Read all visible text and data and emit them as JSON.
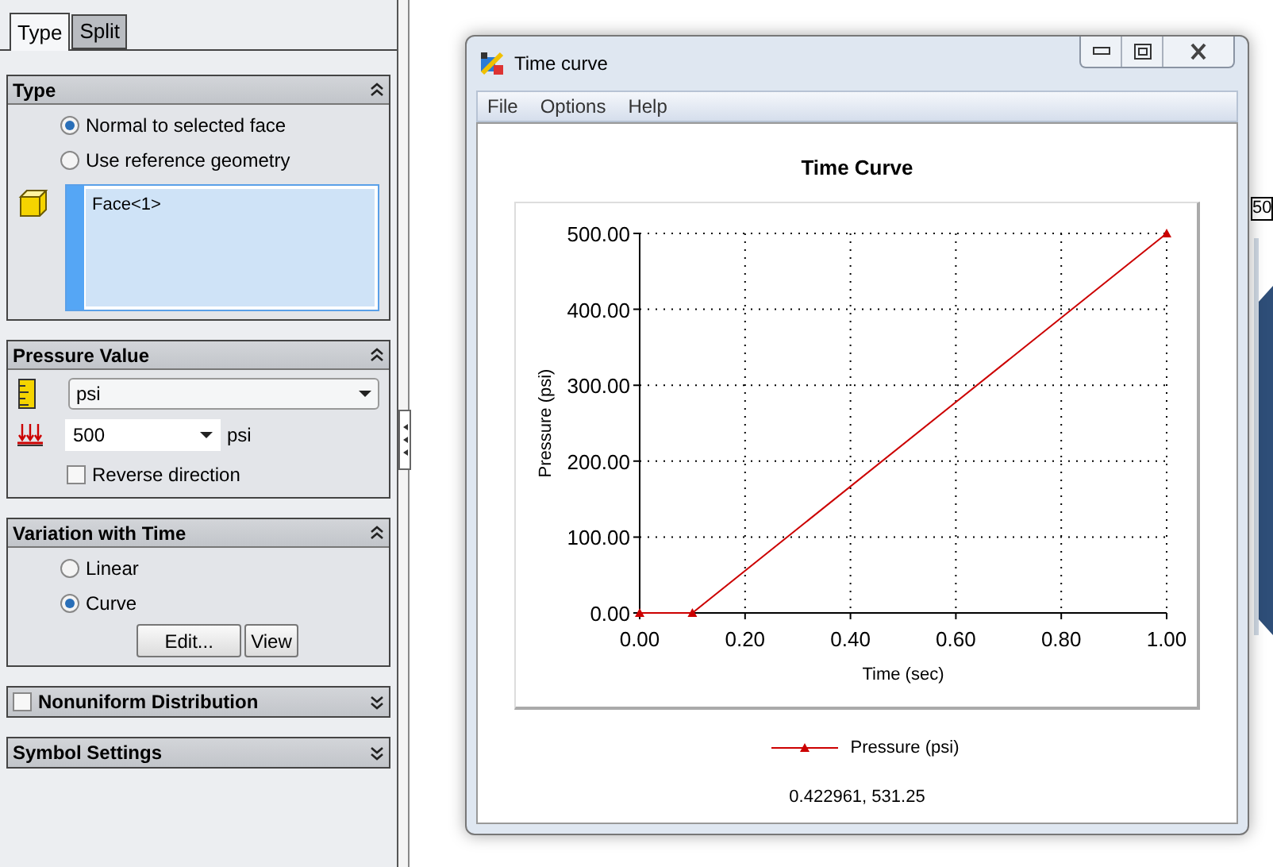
{
  "property_panel": {
    "tabs": [
      {
        "label": "Type",
        "selected": true
      },
      {
        "label": "Split",
        "selected": false
      }
    ],
    "sections": [
      {
        "kind": "type",
        "title": "Type",
        "expanded": true,
        "options": [
          {
            "label": "Normal to selected face",
            "selected": true
          },
          {
            "label": "Use reference geometry",
            "selected": false
          }
        ],
        "selection_list": [
          "Face<1>"
        ]
      },
      {
        "kind": "pressure",
        "title": "Pressure Value",
        "expanded": true,
        "unit_select": "psi",
        "value": "500",
        "value_unit": "psi",
        "reverse": {
          "label": "Reverse direction",
          "checked": false
        }
      },
      {
        "kind": "variation",
        "title": "Variation with Time",
        "expanded": true,
        "options": [
          {
            "label": "Linear",
            "selected": false
          },
          {
            "label": "Curve",
            "selected": true
          }
        ],
        "buttons": [
          "Edit...",
          "View"
        ]
      },
      {
        "kind": "checkable",
        "title": "Nonuniform Distribution",
        "expanded": false,
        "checked": false
      },
      {
        "kind": "plain",
        "title": "Symbol Settings",
        "expanded": false
      }
    ]
  },
  "background_label": "50",
  "window": {
    "title": "Time curve",
    "menu": [
      "File",
      "Options",
      "Help"
    ],
    "chart_data": {
      "type": "line",
      "title": "Time Curve",
      "xlabel": "Time (sec)",
      "ylabel": "Pressure (psi)",
      "x": [
        0,
        0.1,
        1
      ],
      "series": [
        {
          "name": "Pressure (psi)",
          "color": "#cc0000",
          "values": [
            0,
            0,
            500
          ]
        }
      ],
      "grid": true,
      "marker": "triangle",
      "xlim": [
        0,
        1
      ],
      "ylim": [
        0,
        500
      ],
      "xticks": [
        {
          "value": 0,
          "label": "0.00"
        },
        {
          "value": 0.2,
          "label": "0.20"
        },
        {
          "value": 0.4,
          "label": "0.40"
        },
        {
          "value": 0.6,
          "label": "0.60"
        },
        {
          "value": 0.8,
          "label": "0.80"
        },
        {
          "value": 1,
          "label": "1.00"
        }
      ],
      "yticks": [
        {
          "value": 0,
          "label": "0.00"
        },
        {
          "value": 100,
          "label": "100.00"
        },
        {
          "value": 200,
          "label": "200.00"
        },
        {
          "value": 300,
          "label": "300.00"
        },
        {
          "value": 400,
          "label": "400.00"
        },
        {
          "value": 500,
          "label": "500.00"
        }
      ]
    },
    "readout": "0.422961, 531.25"
  }
}
